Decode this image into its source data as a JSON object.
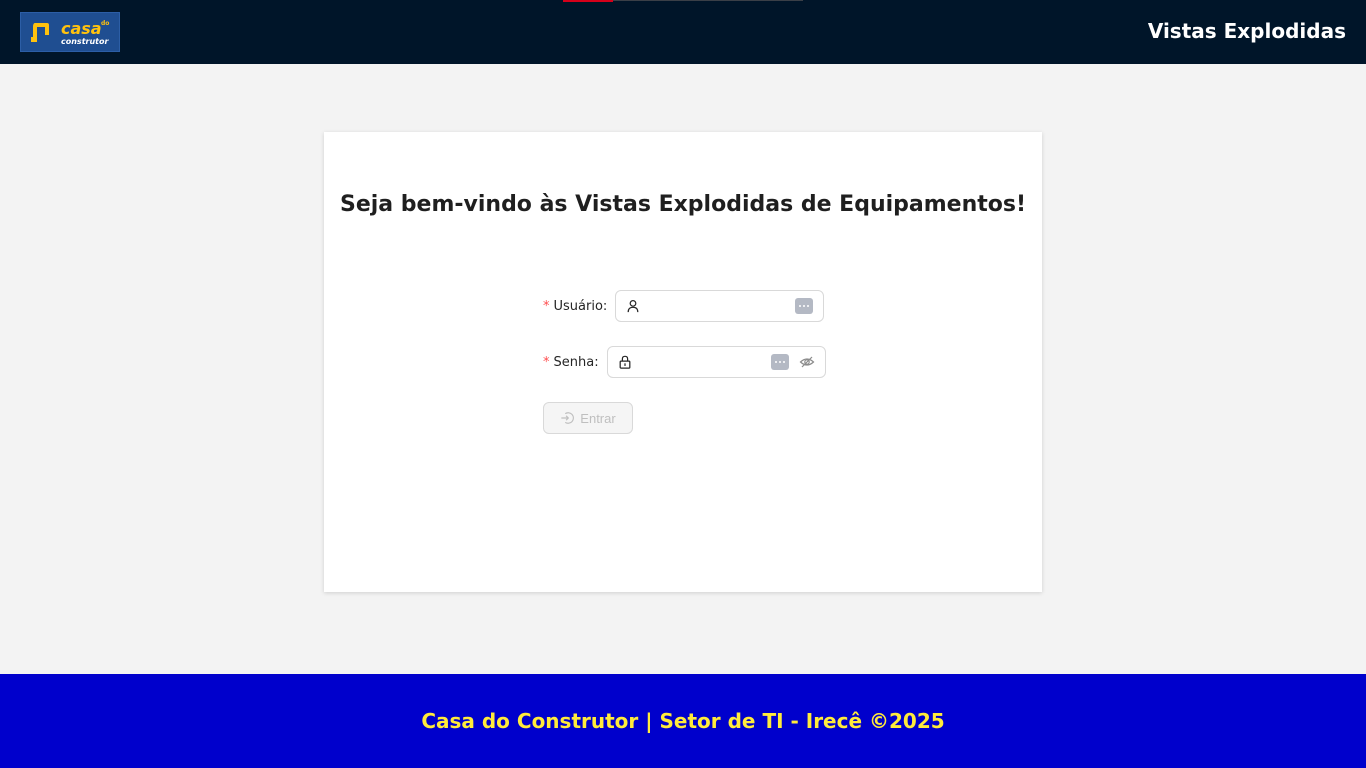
{
  "header": {
    "logo": {
      "brand_top": "casa",
      "brand_small": "do",
      "brand_bottom": "construtor"
    },
    "title": "Vistas Explodidas"
  },
  "login": {
    "welcome": "Seja bem-vindo às Vistas Explodidas de Equipamentos!",
    "username": {
      "label": "Usuário",
      "required_mark": "*",
      "colon": ":",
      "value": "",
      "placeholder": ""
    },
    "password": {
      "label": "Senha",
      "required_mark": "*",
      "colon": ":",
      "value": "",
      "placeholder": ""
    },
    "submit_label": "Entrar",
    "submit_disabled": true
  },
  "footer": {
    "text": "Casa do Construtor | Setor de TI - Irecê ©2025"
  },
  "colors": {
    "header_bg": "#001529",
    "footer_bg": "#0000cc",
    "footer_text": "#ffeb3b",
    "required": "#ff4d4f"
  },
  "icons": {
    "username_prefix": "user-icon",
    "password_prefix": "lock-icon",
    "autofill": "autofill-dots-icon",
    "visibility": "eye-invisible-icon",
    "submit": "login-icon"
  }
}
